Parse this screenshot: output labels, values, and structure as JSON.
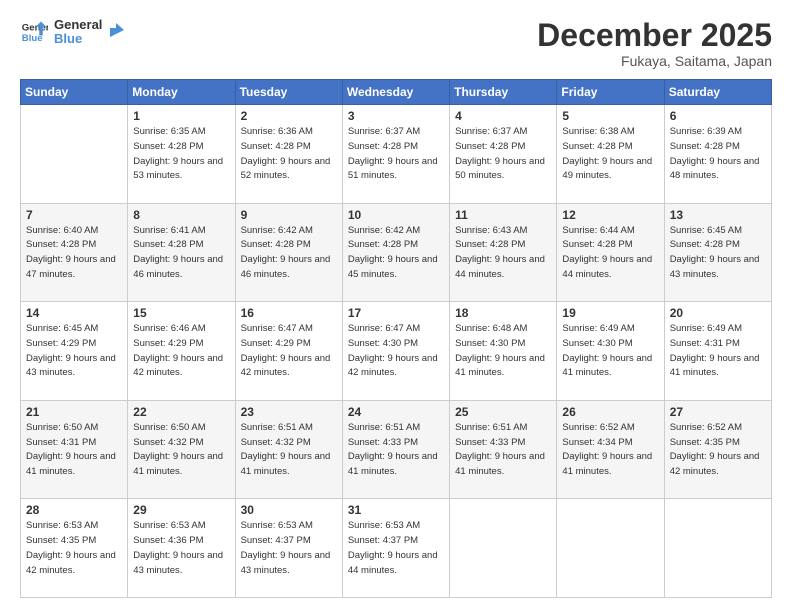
{
  "logo": {
    "line1": "General",
    "line2": "Blue"
  },
  "header": {
    "month": "December 2025",
    "location": "Fukaya, Saitama, Japan"
  },
  "weekdays": [
    "Sunday",
    "Monday",
    "Tuesday",
    "Wednesday",
    "Thursday",
    "Friday",
    "Saturday"
  ],
  "weeks": [
    [
      {
        "day": "",
        "info": ""
      },
      {
        "day": "1",
        "sunrise": "6:35 AM",
        "sunset": "4:28 PM",
        "daylight": "9 hours and 53 minutes."
      },
      {
        "day": "2",
        "sunrise": "6:36 AM",
        "sunset": "4:28 PM",
        "daylight": "9 hours and 52 minutes."
      },
      {
        "day": "3",
        "sunrise": "6:37 AM",
        "sunset": "4:28 PM",
        "daylight": "9 hours and 51 minutes."
      },
      {
        "day": "4",
        "sunrise": "6:37 AM",
        "sunset": "4:28 PM",
        "daylight": "9 hours and 50 minutes."
      },
      {
        "day": "5",
        "sunrise": "6:38 AM",
        "sunset": "4:28 PM",
        "daylight": "9 hours and 49 minutes."
      },
      {
        "day": "6",
        "sunrise": "6:39 AM",
        "sunset": "4:28 PM",
        "daylight": "9 hours and 48 minutes."
      }
    ],
    [
      {
        "day": "7",
        "sunrise": "6:40 AM",
        "sunset": "4:28 PM",
        "daylight": "9 hours and 47 minutes."
      },
      {
        "day": "8",
        "sunrise": "6:41 AM",
        "sunset": "4:28 PM",
        "daylight": "9 hours and 46 minutes."
      },
      {
        "day": "9",
        "sunrise": "6:42 AM",
        "sunset": "4:28 PM",
        "daylight": "9 hours and 46 minutes."
      },
      {
        "day": "10",
        "sunrise": "6:42 AM",
        "sunset": "4:28 PM",
        "daylight": "9 hours and 45 minutes."
      },
      {
        "day": "11",
        "sunrise": "6:43 AM",
        "sunset": "4:28 PM",
        "daylight": "9 hours and 44 minutes."
      },
      {
        "day": "12",
        "sunrise": "6:44 AM",
        "sunset": "4:28 PM",
        "daylight": "9 hours and 44 minutes."
      },
      {
        "day": "13",
        "sunrise": "6:45 AM",
        "sunset": "4:28 PM",
        "daylight": "9 hours and 43 minutes."
      }
    ],
    [
      {
        "day": "14",
        "sunrise": "6:45 AM",
        "sunset": "4:29 PM",
        "daylight": "9 hours and 43 minutes."
      },
      {
        "day": "15",
        "sunrise": "6:46 AM",
        "sunset": "4:29 PM",
        "daylight": "9 hours and 42 minutes."
      },
      {
        "day": "16",
        "sunrise": "6:47 AM",
        "sunset": "4:29 PM",
        "daylight": "9 hours and 42 minutes."
      },
      {
        "day": "17",
        "sunrise": "6:47 AM",
        "sunset": "4:30 PM",
        "daylight": "9 hours and 42 minutes."
      },
      {
        "day": "18",
        "sunrise": "6:48 AM",
        "sunset": "4:30 PM",
        "daylight": "9 hours and 41 minutes."
      },
      {
        "day": "19",
        "sunrise": "6:49 AM",
        "sunset": "4:30 PM",
        "daylight": "9 hours and 41 minutes."
      },
      {
        "day": "20",
        "sunrise": "6:49 AM",
        "sunset": "4:31 PM",
        "daylight": "9 hours and 41 minutes."
      }
    ],
    [
      {
        "day": "21",
        "sunrise": "6:50 AM",
        "sunset": "4:31 PM",
        "daylight": "9 hours and 41 minutes."
      },
      {
        "day": "22",
        "sunrise": "6:50 AM",
        "sunset": "4:32 PM",
        "daylight": "9 hours and 41 minutes."
      },
      {
        "day": "23",
        "sunrise": "6:51 AM",
        "sunset": "4:32 PM",
        "daylight": "9 hours and 41 minutes."
      },
      {
        "day": "24",
        "sunrise": "6:51 AM",
        "sunset": "4:33 PM",
        "daylight": "9 hours and 41 minutes."
      },
      {
        "day": "25",
        "sunrise": "6:51 AM",
        "sunset": "4:33 PM",
        "daylight": "9 hours and 41 minutes."
      },
      {
        "day": "26",
        "sunrise": "6:52 AM",
        "sunset": "4:34 PM",
        "daylight": "9 hours and 41 minutes."
      },
      {
        "day": "27",
        "sunrise": "6:52 AM",
        "sunset": "4:35 PM",
        "daylight": "9 hours and 42 minutes."
      }
    ],
    [
      {
        "day": "28",
        "sunrise": "6:53 AM",
        "sunset": "4:35 PM",
        "daylight": "9 hours and 42 minutes."
      },
      {
        "day": "29",
        "sunrise": "6:53 AM",
        "sunset": "4:36 PM",
        "daylight": "9 hours and 43 minutes."
      },
      {
        "day": "30",
        "sunrise": "6:53 AM",
        "sunset": "4:37 PM",
        "daylight": "9 hours and 43 minutes."
      },
      {
        "day": "31",
        "sunrise": "6:53 AM",
        "sunset": "4:37 PM",
        "daylight": "9 hours and 44 minutes."
      },
      {
        "day": "",
        "info": ""
      },
      {
        "day": "",
        "info": ""
      },
      {
        "day": "",
        "info": ""
      }
    ]
  ]
}
